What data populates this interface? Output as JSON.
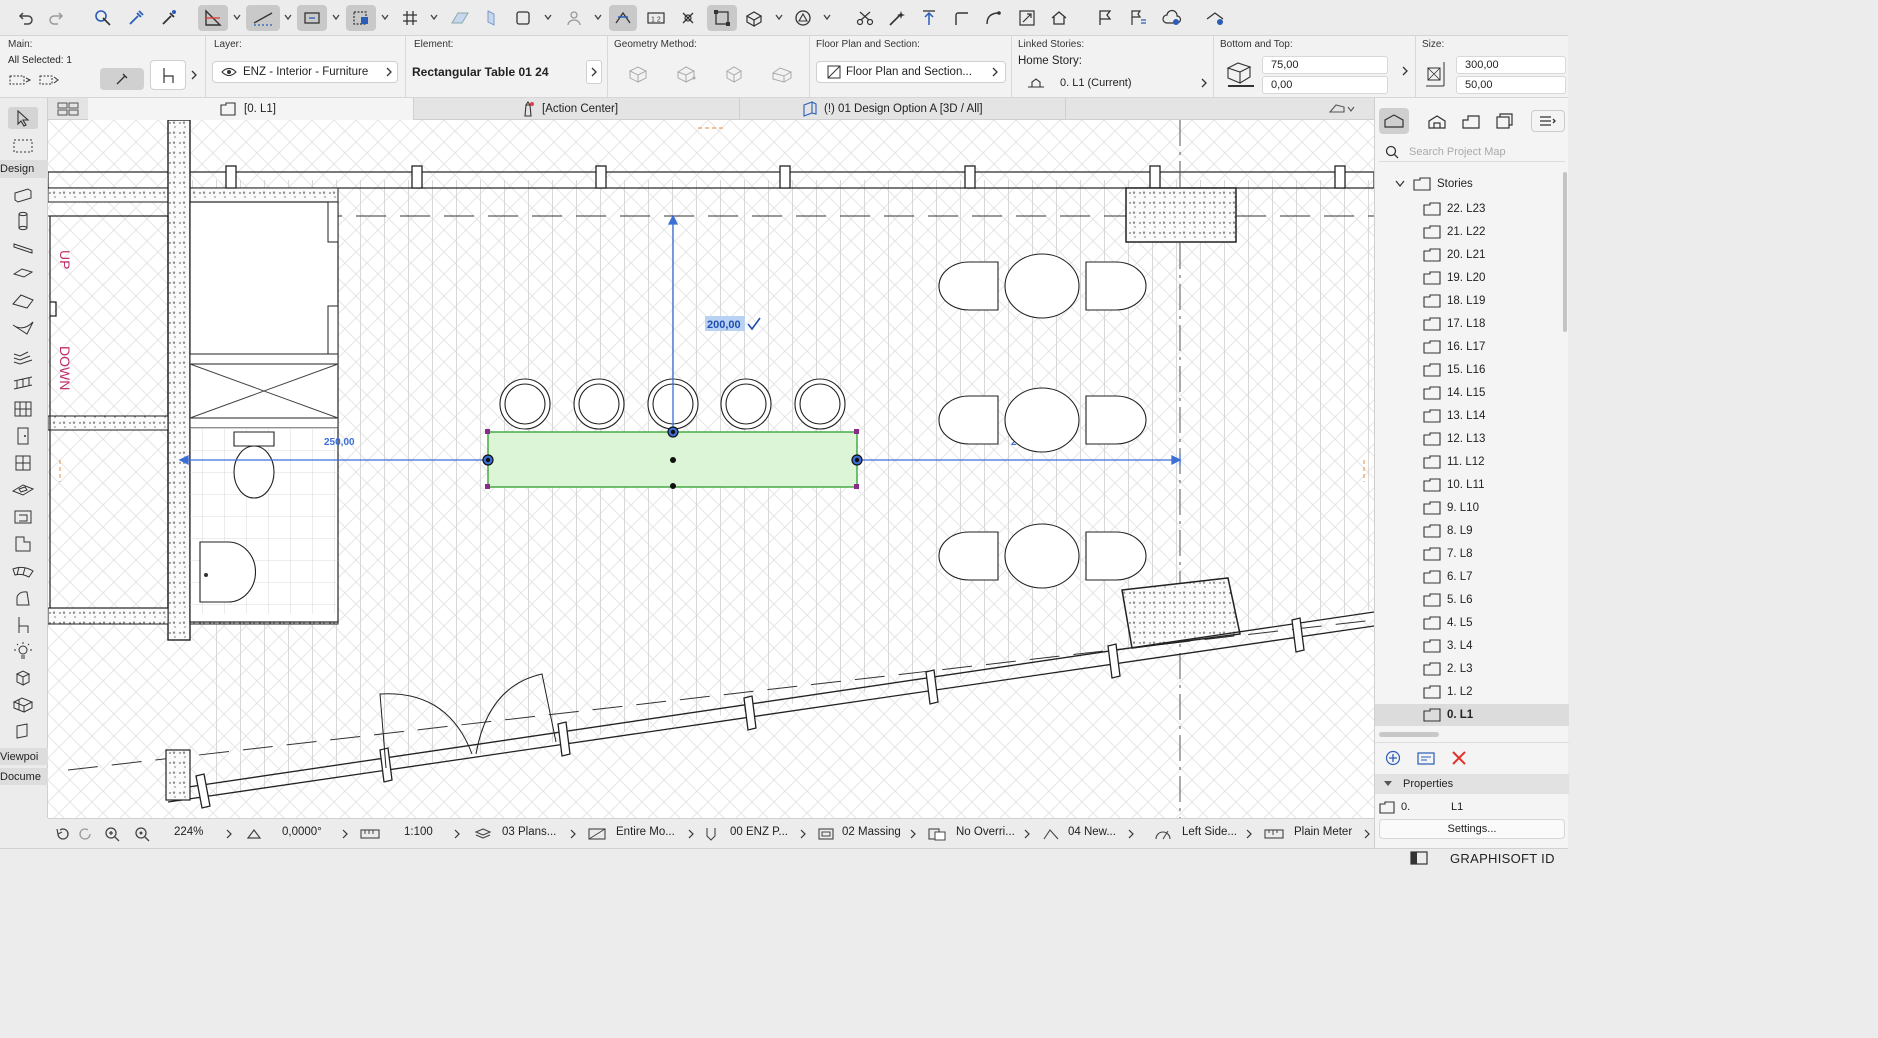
{
  "toolbar": {
    "icons": [
      "undo-icon",
      "redo-icon",
      "pointer-pick-icon",
      "eyedropper-icon",
      "inject-icon",
      "guide-icon",
      "snap-guide-icon",
      "grid-snap-icon",
      "selection-snap-icon",
      "grid-icon",
      "plane-icon",
      "trace-icon",
      "window-icon",
      "person-icon",
      "renovation-icon",
      "measure-icon",
      "cross-icon",
      "frame-icon",
      "3d-box-icon",
      "shape-icon",
      "scissors-icon",
      "magic-wand-icon",
      "elevate-icon",
      "corner-icon",
      "curve-icon",
      "resize-icon",
      "home-icon",
      "flag-icon",
      "list-flag-icon",
      "cloud-icon",
      "teamwork-icon"
    ]
  },
  "infobox": {
    "main": {
      "label": "Main:",
      "selected": "All Selected: 1"
    },
    "layer": {
      "label": "Layer:",
      "value": "ENZ - Interior - Furniture"
    },
    "element": {
      "label": "Element:",
      "value": "Rectangular Table 01 24"
    },
    "geometry": {
      "label": "Geometry Method:"
    },
    "floorplan": {
      "label": "Floor Plan and Section:",
      "value": "Floor Plan and Section..."
    },
    "linked": {
      "label": "Linked Stories:",
      "home_label": "Home Story:",
      "home_value": "0. L1 (Current)"
    },
    "bottomtop": {
      "label": "Bottom and Top:",
      "top": "75,00",
      "bottom": "0,00"
    },
    "size": {
      "label": "Size:",
      "x": "300,00",
      "y": "50,00"
    }
  },
  "tabs": [
    {
      "label": "[0. L1]"
    },
    {
      "label": "[Action Center]"
    },
    {
      "label": "(!) 01 Design Option A [3D / All]"
    }
  ],
  "toolbox": {
    "design_label": "Design",
    "viewpoint_label": "Viewpoi",
    "document_label": "Docume"
  },
  "canvas": {
    "stair_up": "UP",
    "stair_down": "DOWN",
    "dim_left": "250,00",
    "dim_top": "200,00",
    "dim_right": "262,50",
    "selection_fill": "#dcf5d6",
    "selection_stroke": "#3aa63a",
    "dim_color": "#3b6fd6"
  },
  "statusbar": {
    "zoom": "224%",
    "angle": "0,0000°",
    "scale": "1:100",
    "layer_combo": "03 Plans...",
    "structure": "Entire Mo...",
    "pen_set": "00 ENZ P...",
    "model_view": "02 Massing",
    "override": "No Overri...",
    "renovation": "04 New...",
    "dimension": "Left Side...",
    "unit": "Plain Meter"
  },
  "navigator": {
    "search_placeholder": "Search Project Map",
    "root": "Stories",
    "stories": [
      "22. L23",
      "21. L22",
      "20. L21",
      "19. L20",
      "18. L19",
      "17. L18",
      "16. L17",
      "15. L16",
      "14. L15",
      "13. L14",
      "12. L13",
      "11. L12",
      "10. L11",
      "9. L10",
      "8. L9",
      "7. L8",
      "6. L7",
      "5. L6",
      "4. L5",
      "3. L4",
      "2. L3",
      "1. L2",
      "0. L1"
    ],
    "current_story": "0. L1",
    "properties_label": "Properties",
    "prop_id": "0.",
    "prop_name": "L1",
    "settings_label": "Settings..."
  },
  "brand": "GRAPHISOFT ID"
}
